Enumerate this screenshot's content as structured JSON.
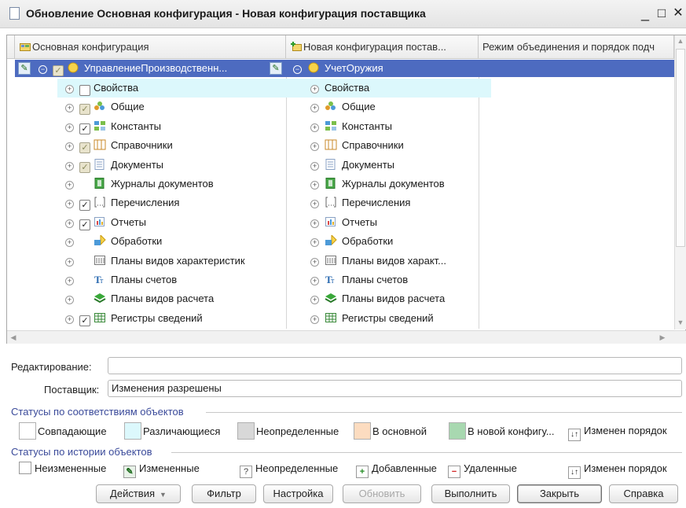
{
  "window": {
    "title": "Обновление Основная конфигурация - Новая конфигурация поставщика",
    "minimize": "_",
    "maximize": "□",
    "close": "✕"
  },
  "columns": {
    "main": "Основная конфигурация",
    "vendor": "Новая конфигурация постав...",
    "mode": "Режим объединения и порядок подч"
  },
  "main_tree": {
    "root": "УправлениеПроизводственн...",
    "items": [
      {
        "label": "Свойства",
        "check": "empty",
        "icon": ""
      },
      {
        "label": "Общие",
        "check": "partial",
        "icon": "common-icon"
      },
      {
        "label": "Константы",
        "check": "checked",
        "icon": "constants-icon"
      },
      {
        "label": "Справочники",
        "check": "partial",
        "icon": "catalogs-icon"
      },
      {
        "label": "Документы",
        "check": "partial",
        "icon": "documents-icon"
      },
      {
        "label": "Журналы документов",
        "check": "",
        "icon": "journals-icon"
      },
      {
        "label": "Перечисления",
        "check": "checked",
        "icon": "enums-icon"
      },
      {
        "label": "Отчеты",
        "check": "checked",
        "icon": "reports-icon"
      },
      {
        "label": "Обработки",
        "check": "",
        "icon": "processing-icon"
      },
      {
        "label": "Планы видов характеристик",
        "check": "",
        "icon": "char-plans-icon"
      },
      {
        "label": "Планы счетов",
        "check": "",
        "icon": "accounts-icon"
      },
      {
        "label": "Планы видов расчета",
        "check": "",
        "icon": "calc-plans-icon"
      },
      {
        "label": "Регистры сведений",
        "check": "checked",
        "icon": "info-registers-icon"
      }
    ]
  },
  "vendor_tree": {
    "root": "УчетОружия",
    "items": [
      {
        "label": "Свойства",
        "icon": ""
      },
      {
        "label": "Общие",
        "icon": "common-icon"
      },
      {
        "label": "Константы",
        "icon": "constants-icon"
      },
      {
        "label": "Справочники",
        "icon": "catalogs-icon"
      },
      {
        "label": "Документы",
        "icon": "documents-icon"
      },
      {
        "label": "Журналы документов",
        "icon": "journals-icon"
      },
      {
        "label": "Перечисления",
        "icon": "enums-icon"
      },
      {
        "label": "Отчеты",
        "icon": "reports-icon"
      },
      {
        "label": "Обработки",
        "icon": "processing-icon"
      },
      {
        "label": "Планы видов характ...",
        "icon": "char-plans-icon"
      },
      {
        "label": "Планы счетов",
        "icon": "accounts-icon"
      },
      {
        "label": "Планы видов расчета",
        "icon": "calc-plans-icon"
      },
      {
        "label": "Регистры сведений",
        "icon": "info-registers-icon"
      }
    ]
  },
  "fields": {
    "editing_label": "Редактирование:",
    "editing_value": "",
    "vendor_label": "Поставщик:",
    "vendor_value": "Изменения разрешены"
  },
  "legend_match": {
    "title": "Статусы по соответствиям объектов",
    "items": [
      {
        "label": "Совпадающие",
        "color": "#ffffff"
      },
      {
        "label": "Различающиеся",
        "color": "#dcf8fc"
      },
      {
        "label": "Неопределенные",
        "color": "#d8d8d8"
      },
      {
        "label": "В основной",
        "color": "#fcdcc0"
      },
      {
        "label": "В новой конфигу...",
        "color": "#a8d8b0"
      },
      {
        "label": "Изменен порядок",
        "icon": "order-changed-icon"
      }
    ]
  },
  "legend_history": {
    "title": "Статусы по истории объектов",
    "items": [
      {
        "label": "Неизмененные",
        "icon": ""
      },
      {
        "label": "Измененные",
        "icon": "modified-icon"
      },
      {
        "label": "Неопределенные",
        "icon": "undefined-icon",
        "glyph": "?"
      },
      {
        "label": "Добавленные",
        "icon": "added-icon",
        "glyph": "+"
      },
      {
        "label": "Удаленные",
        "icon": "deleted-icon",
        "glyph": "−"
      },
      {
        "label": "Изменен порядок",
        "icon": "order-changed-icon"
      }
    ]
  },
  "buttons": {
    "actions": "Действия",
    "filter": "Фильтр",
    "settings": "Настройка",
    "refresh": "Обновить",
    "execute": "Выполнить",
    "close": "Закрыть",
    "help": "Справка"
  },
  "colors": {
    "selection": "#4d6bc0",
    "group_title": "#3a4a9a",
    "row_highlight": "#dcf8fc"
  }
}
